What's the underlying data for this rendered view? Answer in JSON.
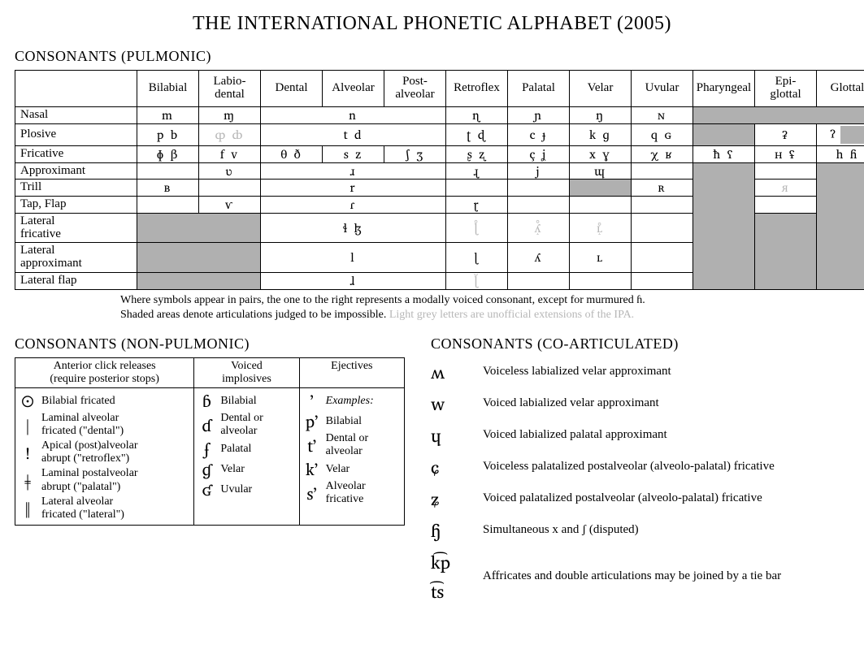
{
  "title": "THE INTERNATIONAL PHONETIC ALPHABET (2005)",
  "pulmonic": {
    "heading": "CONSONANTS (PULMONIC)",
    "columns": [
      "Bilabial",
      "Labio-\ndental",
      "Dental",
      "Alveolar",
      "Post-\nalveolar",
      "Retroflex",
      "Palatal",
      "Velar",
      "Uvular",
      "Pharyngeal",
      "Epi-\nglottal",
      "Glottal"
    ],
    "rows": {
      "nasal": {
        "label": "Nasal",
        "bilabial": "m",
        "labiodental": "ɱ",
        "dental_group": "n",
        "retroflex": "ɳ",
        "palatal": "ɲ",
        "velar": "ŋ",
        "uvular": "ɴ"
      },
      "plosive": {
        "label": "Plosive",
        "bilabial": "p  b",
        "labiodental": "ȹ  ȸ",
        "dental_group": "t  d",
        "retroflex": "ʈ  ɖ",
        "palatal": "c  ɟ",
        "velar": "k  ɡ",
        "uvular": "q  ɢ",
        "epiglottal": "ʡ",
        "glottal": "ʔ"
      },
      "fricative": {
        "label": "Fricative",
        "bilabial": "ɸ  β",
        "labiodental": "f  v",
        "dental": "θ  ð",
        "alveolar": "s  z",
        "postalveolar": "ʃ  ʒ",
        "retroflex": "ʂ  ʐ",
        "palatal": "ç  ʝ",
        "velar": "x  ɣ",
        "uvular": "χ  ʁ",
        "pharyngeal": "ħ  ʕ",
        "epiglottal": "ʜ  ʢ",
        "glottal": "h  ɦ"
      },
      "approximant": {
        "label": "Approximant",
        "labiodental": "ʋ",
        "dental_group": "ɹ",
        "retroflex": "ɻ",
        "palatal": "j",
        "velar": "ɰ"
      },
      "trill": {
        "label": "Trill",
        "bilabial": "ʙ",
        "dental_group": "r",
        "uvular": "ʀ",
        "epiglottal": "я"
      },
      "tap": {
        "label": "Tap, Flap",
        "labiodental": "ⱱ",
        "dental_group": "ɾ",
        "retroflex": "ɽ"
      },
      "latfric": {
        "label": "Lateral\nfricative",
        "dental_group": "ɬ  ɮ",
        "retroflex": "ɭ̊",
        "palatal": "ʎ̝̊",
        "velar": "ʟ̝̊"
      },
      "latapprox": {
        "label": "Lateral\napproximant",
        "dental_group": "l",
        "retroflex": "ɭ",
        "palatal": "ʎ",
        "velar": "ʟ"
      },
      "latflap": {
        "label": "Lateral flap",
        "dental_group": "ɺ",
        "retroflex": "ɭ̆"
      }
    },
    "caption1": "Where symbols appear in pairs, the one to the right represents a modally voiced consonant, except for murmured ɦ.",
    "caption2a": "Shaded areas denote articulations judged to be impossible. ",
    "caption2b": "Light grey letters are unofficial extensions of the IPA."
  },
  "nonpulmonic": {
    "heading": "CONSONANTS (NON-PULMONIC)",
    "th_clicks_a": "Anterior click releases",
    "th_clicks_b": "(require posterior stops)",
    "th_impl_a": "Voiced",
    "th_impl_b": "implosives",
    "th_ej": "Ejectives",
    "clicks": [
      {
        "sym": "ʘ",
        "label": "Bilabial fricated"
      },
      {
        "sym": "ǀ",
        "label": "Laminal alveolar\nfricated (\"dental\")"
      },
      {
        "sym": "ǃ",
        "label": "Apical (post)alveolar\nabrupt (\"retroflex\")"
      },
      {
        "sym": "ǂ",
        "label": "Laminal postalveolar\nabrupt (\"palatal\")"
      },
      {
        "sym": "ǁ",
        "label": "Lateral alveolar\nfricated (\"lateral\")"
      }
    ],
    "implosives": [
      {
        "sym": "ɓ",
        "label": "Bilabial"
      },
      {
        "sym": "ɗ",
        "label": "Dental or\nalveolar"
      },
      {
        "sym": "ʄ",
        "label": "Palatal"
      },
      {
        "sym": "ɠ",
        "label": "Velar"
      },
      {
        "sym": "ʛ",
        "label": "Uvular"
      }
    ],
    "ejectives": [
      {
        "sym": "ʼ",
        "label": "Examples:",
        "italic": true
      },
      {
        "sym": "pʼ",
        "label": "Bilabial"
      },
      {
        "sym": "tʼ",
        "label": "Dental or\nalveolar"
      },
      {
        "sym": "kʼ",
        "label": "Velar"
      },
      {
        "sym": "sʼ",
        "label": "Alveolar\nfricative"
      }
    ]
  },
  "coarticulated": {
    "heading": "CONSONANTS (CO-ARTICULATED)",
    "items": [
      {
        "sym": "ʍ",
        "label": "Voiceless labialized velar approximant"
      },
      {
        "sym": "w",
        "label": "Voiced labialized velar approximant"
      },
      {
        "sym": "ɥ",
        "label": "Voiced labialized palatal approximant"
      },
      {
        "sym": "ɕ",
        "label": "Voiceless palatalized postalveolar (alveolo-palatal) fricative"
      },
      {
        "sym": "ʑ",
        "label": "Voiced palatalized postalveolar (alveolo-palatal) fricative"
      },
      {
        "sym": "ɧ",
        "label": "Simultaneous x and ʃ   (disputed)"
      },
      {
        "sym": "k͡p  t͡s",
        "label": "Affricates and double articulations may be joined by a tie bar"
      }
    ]
  }
}
